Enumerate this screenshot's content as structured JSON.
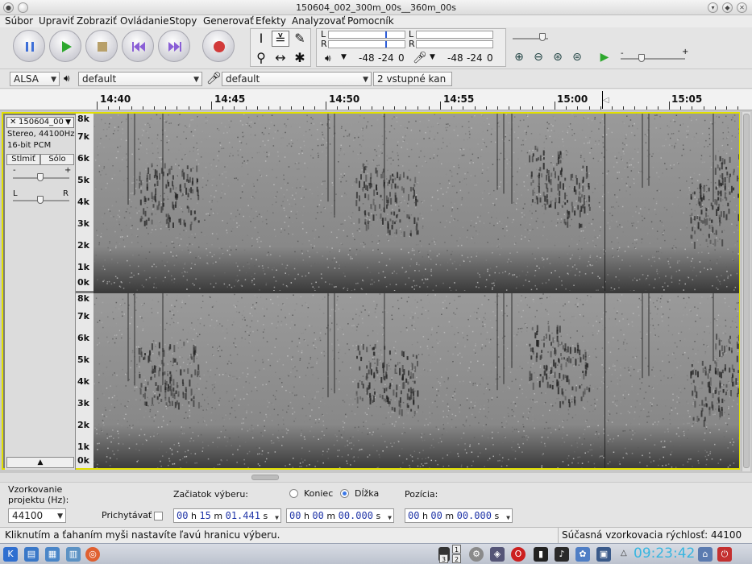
{
  "window": {
    "title": "150604_002_300m_00s__360m_00s"
  },
  "menu": [
    "Súbor",
    "Upraviť",
    "Zobraziť",
    "Ovládanie",
    "Stopy",
    "Generovať",
    "Efekty",
    "Analyzovať",
    "Pomocník"
  ],
  "meters": {
    "play_label": "L",
    "play_label_r": "R",
    "rec_label": "L",
    "rec_label_r": "R",
    "scale_a": "-48",
    "scale_b": "-24",
    "scale_c": "0"
  },
  "device": {
    "host": "ALSA",
    "output": "default",
    "input": "default",
    "channels": "2 vstupné kan"
  },
  "timeline": {
    "ticks": [
      "14:40",
      "14:45",
      "14:50",
      "14:55",
      "15:00",
      "15:05"
    ]
  },
  "track": {
    "name": "150604_00",
    "format": "Stereo, 44100Hz",
    "bits": "16-bit PCM",
    "mute": "Stlmiť",
    "solo": "Sólo",
    "gain_minus": "-",
    "gain_plus": "+",
    "pan_left": "L",
    "pan_right": "R",
    "freq_labels": [
      "8k",
      "7k",
      "6k",
      "5k",
      "4k",
      "3k",
      "2k",
      "1k",
      "0k"
    ]
  },
  "selection": {
    "rate_label_1": "Vzorkovanie",
    "rate_label_2": "projektu (Hz):",
    "rate_value": "44100",
    "snap_label": "Prichytávať",
    "start_label": "Začiatok výberu:",
    "end_label": "Koniec",
    "length_label": "Dĺžka",
    "position_label": "Pozícia:",
    "start": {
      "h": "00",
      "m": "15",
      "s": "01.441"
    },
    "length": {
      "h": "00",
      "m": "00",
      "s": "00.000"
    },
    "position": {
      "h": "00",
      "m": "00",
      "s": "00.000"
    }
  },
  "status": {
    "hint": "Kliknutím a ťahaním myši nastavíte ľavú hranicu výberu.",
    "rate": "Súčasná vzorkovacia rýchlosť: 44100"
  },
  "taskbar": {
    "clock": "09:23:42",
    "pager": [
      "1",
      "2",
      "3",
      "4"
    ]
  }
}
